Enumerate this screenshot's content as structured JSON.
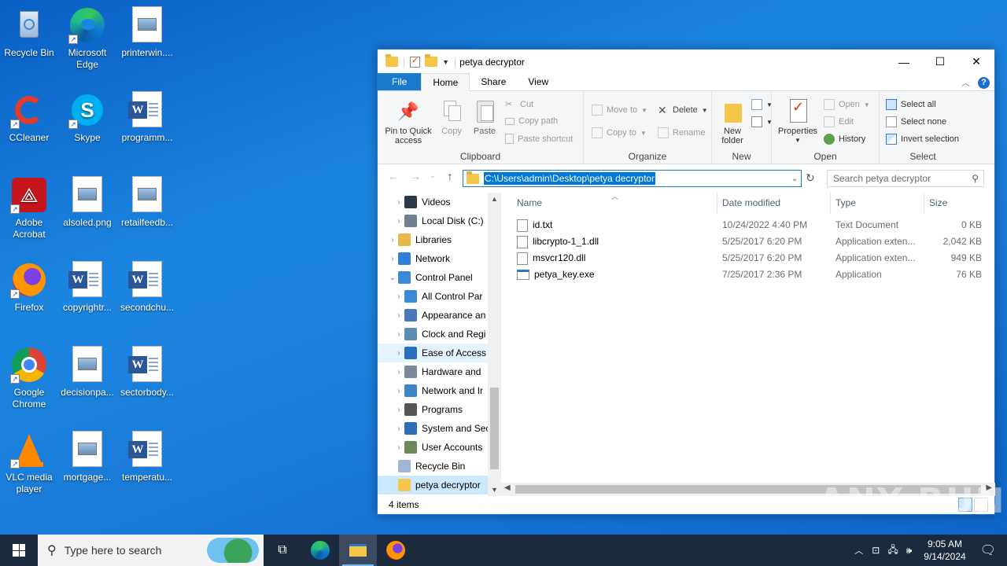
{
  "desktop": {
    "icons": [
      {
        "label": "Recycle Bin"
      },
      {
        "label": "Microsoft Edge"
      },
      {
        "label": "printerwin...."
      },
      {
        "label": "CCleaner"
      },
      {
        "label": "Skype"
      },
      {
        "label": "programm..."
      },
      {
        "label": "Adobe Acrobat"
      },
      {
        "label": "alsoled.png"
      },
      {
        "label": "retailfeedb..."
      },
      {
        "label": "Firefox"
      },
      {
        "label": "copyrightr..."
      },
      {
        "label": "secondchu..."
      },
      {
        "label": "Google Chrome"
      },
      {
        "label": "decisionpa..."
      },
      {
        "label": "sectorbody..."
      },
      {
        "label": "VLC media player"
      },
      {
        "label": "mortgage..."
      },
      {
        "label": "temperatu..."
      }
    ]
  },
  "explorer": {
    "title": "petya decryptor",
    "tabs": [
      "File",
      "Home",
      "Share",
      "View"
    ],
    "ribbon": {
      "clipboard": {
        "pin": "Pin to Quick access",
        "copy": "Copy",
        "paste": "Paste",
        "cut": "Cut",
        "copy_path": "Copy path",
        "paste_shortcut": "Paste shortcut",
        "label": "Clipboard"
      },
      "organize": {
        "move_to": "Move to",
        "copy_to": "Copy to",
        "delete": "Delete",
        "rename": "Rename",
        "label": "Organize"
      },
      "new": {
        "new_folder": "New folder",
        "label": "New"
      },
      "open": {
        "properties": "Properties",
        "open": "Open",
        "edit": "Edit",
        "history": "History",
        "label": "Open"
      },
      "select": {
        "select_all": "Select all",
        "select_none": "Select none",
        "invert": "Invert selection",
        "label": "Select"
      }
    },
    "address": "C:\\Users\\admin\\Desktop\\petya decryptor",
    "search_placeholder": "Search petya decryptor",
    "nav": [
      {
        "label": "Videos",
        "indent": 1
      },
      {
        "label": "Local Disk (C:)",
        "indent": 1
      },
      {
        "label": "Libraries",
        "indent": 0
      },
      {
        "label": "Network",
        "indent": 0
      },
      {
        "label": "Control Panel",
        "indent": 0
      },
      {
        "label": "All Control Par",
        "indent": 1
      },
      {
        "label": "Appearance an",
        "indent": 1
      },
      {
        "label": "Clock and Regi",
        "indent": 1
      },
      {
        "label": "Ease of Access",
        "indent": 1
      },
      {
        "label": "Hardware and",
        "indent": 1
      },
      {
        "label": "Network and Ir",
        "indent": 1
      },
      {
        "label": "Programs",
        "indent": 1
      },
      {
        "label": "System and Sec",
        "indent": 1
      },
      {
        "label": "User Accounts",
        "indent": 1
      },
      {
        "label": "Recycle Bin",
        "indent": 0
      },
      {
        "label": "petya decryptor",
        "indent": 0
      }
    ],
    "columns": {
      "name": "Name",
      "date": "Date modified",
      "type": "Type",
      "size": "Size"
    },
    "files": [
      {
        "name": "id.txt",
        "date": "10/24/2022 4:40 PM",
        "type": "Text Document",
        "size": "0 KB"
      },
      {
        "name": "libcrypto-1_1.dll",
        "date": "5/25/2017 6:20 PM",
        "type": "Application exten...",
        "size": "2,042 KB"
      },
      {
        "name": "msvcr120.dll",
        "date": "5/25/2017 6:20 PM",
        "type": "Application exten...",
        "size": "949 KB"
      },
      {
        "name": "petya_key.exe",
        "date": "7/25/2017 2:36 PM",
        "type": "Application",
        "size": "76 KB"
      }
    ],
    "status": "4 items"
  },
  "taskbar": {
    "search_placeholder": "Type here to search",
    "time": "9:05 AM",
    "date": "9/14/2024"
  },
  "watermark": "ANY RUN"
}
